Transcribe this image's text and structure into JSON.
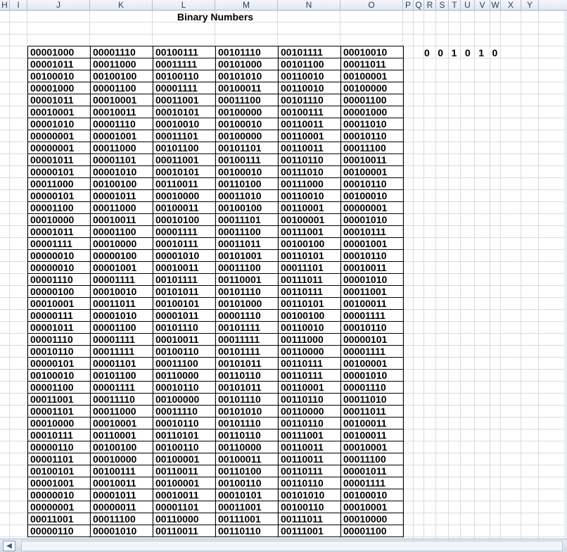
{
  "columns": [
    "H",
    "I",
    "J",
    "K",
    "L",
    "M",
    "N",
    "O",
    "P",
    "Q",
    "R",
    "S",
    "T",
    "U",
    "V",
    "W",
    "X",
    "Y"
  ],
  "title": "Binary Numbers",
  "side_digits": [
    "0",
    "0",
    "1",
    "0",
    "1",
    "0"
  ],
  "rows": [
    [
      "00001000",
      "00001110",
      "00100111",
      "00101110",
      "00101111",
      "00010010"
    ],
    [
      "00001011",
      "00011000",
      "00011111",
      "00101000",
      "00101100",
      "00011011"
    ],
    [
      "00100010",
      "00100100",
      "00100110",
      "00101010",
      "00110010",
      "00100001"
    ],
    [
      "00001000",
      "00001100",
      "00001111",
      "00100011",
      "00110010",
      "00100000"
    ],
    [
      "00001011",
      "00010001",
      "00011001",
      "00011100",
      "00101110",
      "00001100"
    ],
    [
      "00010001",
      "00010011",
      "00010101",
      "00100000",
      "00100111",
      "00001000"
    ],
    [
      "00001010",
      "00001110",
      "00010010",
      "00100010",
      "00110011",
      "00011010"
    ],
    [
      "00000001",
      "00001001",
      "00011101",
      "00100000",
      "00110001",
      "00010110"
    ],
    [
      "00000001",
      "00011000",
      "00101100",
      "00101101",
      "00110011",
      "00011100"
    ],
    [
      "00001011",
      "00001101",
      "00011001",
      "00100111",
      "00110110",
      "00010011"
    ],
    [
      "00000101",
      "00001010",
      "00010101",
      "00100010",
      "00111010",
      "00100001"
    ],
    [
      "00011000",
      "00100100",
      "00110011",
      "00110100",
      "00111000",
      "00010110"
    ],
    [
      "00000101",
      "00001011",
      "00010000",
      "00011010",
      "00110010",
      "00100010"
    ],
    [
      "00001100",
      "00011000",
      "00100011",
      "00100100",
      "00110001",
      "00000001"
    ],
    [
      "00010000",
      "00010011",
      "00010100",
      "00011101",
      "00100001",
      "00001010"
    ],
    [
      "00001011",
      "00001100",
      "00001111",
      "00011100",
      "00111001",
      "00010111"
    ],
    [
      "00001111",
      "00010000",
      "00010111",
      "00011011",
      "00100100",
      "00001001"
    ],
    [
      "00000010",
      "00000100",
      "00001010",
      "00101001",
      "00110101",
      "00010110"
    ],
    [
      "00000010",
      "00001001",
      "00010011",
      "00011100",
      "00011101",
      "00010011"
    ],
    [
      "00001110",
      "00001111",
      "00101111",
      "00110001",
      "00111011",
      "00001010"
    ],
    [
      "00000100",
      "00010010",
      "00101011",
      "00101110",
      "00110111",
      "00011001"
    ],
    [
      "00010001",
      "00011011",
      "00100101",
      "00101000",
      "00110101",
      "00100011"
    ],
    [
      "00000111",
      "00001010",
      "00001011",
      "00001110",
      "00100100",
      "00001111"
    ],
    [
      "00001011",
      "00001100",
      "00101110",
      "00101111",
      "00110010",
      "00010110"
    ],
    [
      "00001110",
      "00001111",
      "00010011",
      "00011111",
      "00111000",
      "00000101"
    ],
    [
      "00010110",
      "00011111",
      "00100110",
      "00101111",
      "00110000",
      "00001111"
    ],
    [
      "00000101",
      "00001101",
      "00011100",
      "00101011",
      "00110111",
      "00100001"
    ],
    [
      "00100010",
      "00101100",
      "00110000",
      "00110110",
      "00110111",
      "00001010"
    ],
    [
      "00001100",
      "00001111",
      "00010110",
      "00101011",
      "00110001",
      "00001110"
    ],
    [
      "00011001",
      "00011110",
      "00100000",
      "00101110",
      "00110110",
      "00011010"
    ],
    [
      "00001101",
      "00011000",
      "00011110",
      "00101010",
      "00110000",
      "00011011"
    ],
    [
      "00010000",
      "00010001",
      "00010110",
      "00101110",
      "00110110",
      "00100011"
    ],
    [
      "00010111",
      "00110001",
      "00110101",
      "00110110",
      "00111001",
      "00100011"
    ],
    [
      "00000110",
      "00100100",
      "00100110",
      "00110000",
      "00110011",
      "00010001"
    ],
    [
      "00001101",
      "00010000",
      "00100001",
      "00100011",
      "00110011",
      "00011100"
    ],
    [
      "00100101",
      "00100111",
      "00110011",
      "00110100",
      "00110111",
      "00001011"
    ],
    [
      "00001001",
      "00010011",
      "00100001",
      "00100110",
      "00110110",
      "00001111"
    ],
    [
      "00000010",
      "00001011",
      "00010011",
      "00010101",
      "00101010",
      "00100010"
    ],
    [
      "00000001",
      "00000011",
      "00001101",
      "00011001",
      "00100110",
      "00010001"
    ],
    [
      "00011001",
      "00011100",
      "00110000",
      "00111001",
      "00111011",
      "00010000"
    ],
    [
      "00000110",
      "00001010",
      "00110011",
      "00110110",
      "00111001",
      "00001100"
    ]
  ]
}
